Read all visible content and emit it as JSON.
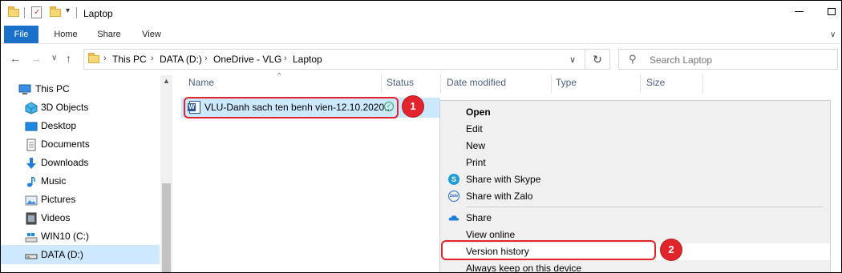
{
  "window": {
    "title": "Laptop"
  },
  "ribbon": {
    "tabs": [
      "File",
      "Home",
      "Share",
      "View"
    ]
  },
  "address": {
    "crumbs": [
      "This PC",
      "DATA (D:)",
      "OneDrive - VLG",
      "Laptop"
    ],
    "search_placeholder": "Search Laptop"
  },
  "nav": {
    "items": [
      {
        "label": "This PC",
        "icon": "this-pc-icon"
      },
      {
        "label": "3D Objects",
        "icon": "3d-objects-icon"
      },
      {
        "label": "Desktop",
        "icon": "desktop-icon"
      },
      {
        "label": "Documents",
        "icon": "documents-icon"
      },
      {
        "label": "Downloads",
        "icon": "downloads-icon"
      },
      {
        "label": "Music",
        "icon": "music-icon"
      },
      {
        "label": "Pictures",
        "icon": "pictures-icon"
      },
      {
        "label": "Videos",
        "icon": "videos-icon"
      },
      {
        "label": "WIN10 (C:)",
        "icon": "drive-c-icon"
      },
      {
        "label": "DATA (D:)",
        "icon": "drive-d-icon",
        "selected": true
      }
    ]
  },
  "columns": [
    "Name",
    "Status",
    "Date modified",
    "Type",
    "Size"
  ],
  "file": {
    "name": "VLU-Danh sach ten benh vien-12.10.2020...",
    "status_icon": "synced-check-icon"
  },
  "context_menu": {
    "items": [
      "Open",
      "Edit",
      "New",
      "Print",
      "Share with Skype",
      "Share with Zalo",
      "Share",
      "View online",
      "Version history",
      "Always keep on this device"
    ]
  },
  "annotations": [
    "1",
    "2"
  ],
  "colors": {
    "accent": "#1a6fc9",
    "selection": "#cce8ff",
    "highlight": "#e2252c"
  }
}
